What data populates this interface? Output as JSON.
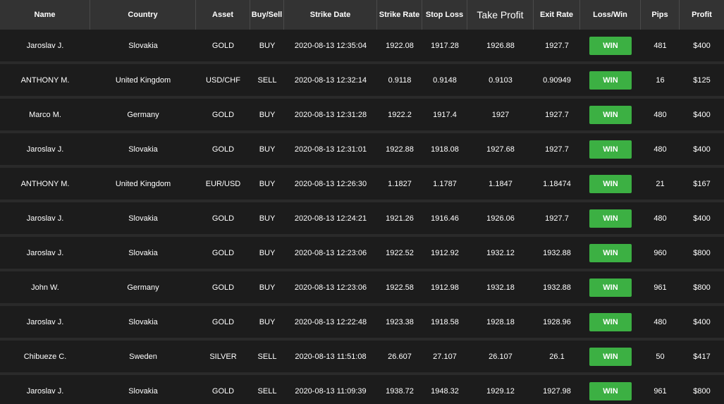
{
  "colors": {
    "background": "#1c1c1c",
    "header_background": "#333333",
    "row_separator": "#2a2a2a",
    "win_badge": "#3cb043",
    "text": "#ffffff"
  },
  "headers": {
    "name": "Name",
    "country": "Country",
    "asset": "Asset",
    "buy_sell": "Buy/Sell",
    "strike_date": "Strike Date",
    "strike_rate": "Strike Rate",
    "stop_loss": "Stop Loss",
    "take_profit": "Take Profit",
    "exit_rate": "Exit Rate",
    "loss_win": "Loss/Win",
    "pips": "Pips",
    "profit": "Profit"
  },
  "rows": [
    {
      "name": "Jaroslav J.",
      "country": "Slovakia",
      "asset": "GOLD",
      "buy_sell": "BUY",
      "strike_date": "2020-08-13 12:35:04",
      "strike_rate": "1922.08",
      "stop_loss": "1917.28",
      "take_profit": "1926.88",
      "exit_rate": "1927.7",
      "loss_win": "WIN",
      "pips": "481",
      "profit": "$400"
    },
    {
      "name": "ANTHONY M.",
      "country": "United Kingdom",
      "asset": "USD/CHF",
      "buy_sell": "SELL",
      "strike_date": "2020-08-13 12:32:14",
      "strike_rate": "0.9118",
      "stop_loss": "0.9148",
      "take_profit": "0.9103",
      "exit_rate": "0.90949",
      "loss_win": "WIN",
      "pips": "16",
      "profit": "$125"
    },
    {
      "name": "Marco M.",
      "country": "Germany",
      "asset": "GOLD",
      "buy_sell": "BUY",
      "strike_date": "2020-08-13 12:31:28",
      "strike_rate": "1922.2",
      "stop_loss": "1917.4",
      "take_profit": "1927",
      "exit_rate": "1927.7",
      "loss_win": "WIN",
      "pips": "480",
      "profit": "$400"
    },
    {
      "name": "Jaroslav J.",
      "country": "Slovakia",
      "asset": "GOLD",
      "buy_sell": "BUY",
      "strike_date": "2020-08-13 12:31:01",
      "strike_rate": "1922.88",
      "stop_loss": "1918.08",
      "take_profit": "1927.68",
      "exit_rate": "1927.7",
      "loss_win": "WIN",
      "pips": "480",
      "profit": "$400"
    },
    {
      "name": "ANTHONY M.",
      "country": "United Kingdom",
      "asset": "EUR/USD",
      "buy_sell": "BUY",
      "strike_date": "2020-08-13 12:26:30",
      "strike_rate": "1.1827",
      "stop_loss": "1.1787",
      "take_profit": "1.1847",
      "exit_rate": "1.18474",
      "loss_win": "WIN",
      "pips": "21",
      "profit": "$167"
    },
    {
      "name": "Jaroslav J.",
      "country": "Slovakia",
      "asset": "GOLD",
      "buy_sell": "BUY",
      "strike_date": "2020-08-13 12:24:21",
      "strike_rate": "1921.26",
      "stop_loss": "1916.46",
      "take_profit": "1926.06",
      "exit_rate": "1927.7",
      "loss_win": "WIN",
      "pips": "480",
      "profit": "$400"
    },
    {
      "name": "Jaroslav J.",
      "country": "Slovakia",
      "asset": "GOLD",
      "buy_sell": "BUY",
      "strike_date": "2020-08-13 12:23:06",
      "strike_rate": "1922.52",
      "stop_loss": "1912.92",
      "take_profit": "1932.12",
      "exit_rate": "1932.88",
      "loss_win": "WIN",
      "pips": "960",
      "profit": "$800"
    },
    {
      "name": "John W.",
      "country": "Germany",
      "asset": "GOLD",
      "buy_sell": "BUY",
      "strike_date": "2020-08-13 12:23:06",
      "strike_rate": "1922.58",
      "stop_loss": "1912.98",
      "take_profit": "1932.18",
      "exit_rate": "1932.88",
      "loss_win": "WIN",
      "pips": "961",
      "profit": "$800"
    },
    {
      "name": "Jaroslav J.",
      "country": "Slovakia",
      "asset": "GOLD",
      "buy_sell": "BUY",
      "strike_date": "2020-08-13 12:22:48",
      "strike_rate": "1923.38",
      "stop_loss": "1918.58",
      "take_profit": "1928.18",
      "exit_rate": "1928.96",
      "loss_win": "WIN",
      "pips": "480",
      "profit": "$400"
    },
    {
      "name": "Chibueze C.",
      "country": "Sweden",
      "asset": "SILVER",
      "buy_sell": "SELL",
      "strike_date": "2020-08-13 11:51:08",
      "strike_rate": "26.607",
      "stop_loss": "27.107",
      "take_profit": "26.107",
      "exit_rate": "26.1",
      "loss_win": "WIN",
      "pips": "50",
      "profit": "$417"
    },
    {
      "name": "Jaroslav J.",
      "country": "Slovakia",
      "asset": "GOLD",
      "buy_sell": "SELL",
      "strike_date": "2020-08-13 11:09:39",
      "strike_rate": "1938.72",
      "stop_loss": "1948.32",
      "take_profit": "1929.12",
      "exit_rate": "1927.98",
      "loss_win": "WIN",
      "pips": "961",
      "profit": "$800"
    }
  ]
}
